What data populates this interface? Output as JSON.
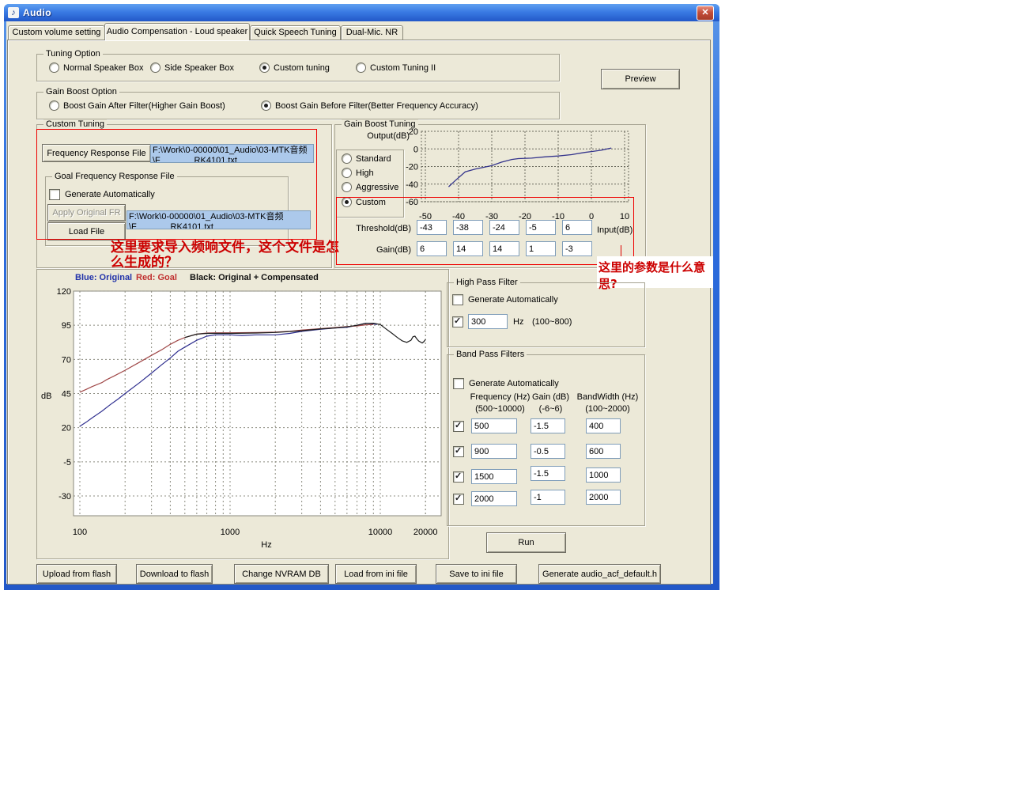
{
  "window": {
    "title": "Audio",
    "close_glyph": "✕",
    "app_icon_glyph": "♪"
  },
  "tabs": [
    {
      "label": "Custom volume setting",
      "active": false
    },
    {
      "label": "Audio Compensation - Loud speaker",
      "active": true
    },
    {
      "label": "Quick Speech Tuning",
      "active": false
    },
    {
      "label": "Dual-Mic. NR",
      "active": false
    }
  ],
  "tuning_option": {
    "title": "Tuning Option",
    "options": [
      {
        "label": "Normal Speaker Box",
        "selected": false
      },
      {
        "label": "Side Speaker Box",
        "selected": false
      },
      {
        "label": "Custom tuning",
        "selected": true
      },
      {
        "label": "Custom Tuning II",
        "selected": false
      }
    ]
  },
  "preview_button": "Preview",
  "gain_boost_option": {
    "title": "Gain Boost Option",
    "options": [
      {
        "label": "Boost Gain After Filter(Higher Gain Boost)",
        "selected": false
      },
      {
        "label": "Boost Gain Before Filter(Better Frequency Accuracy)",
        "selected": true
      }
    ]
  },
  "custom_tuning": {
    "title": "Custom Tuning",
    "frequency_response_button": "Frequency Response File",
    "fr_path_line1": "F:\\Work\\0-00000\\01_Audio\\03-MTK音频",
    "fr_path_line2": "\\F              RK4101.txt",
    "goal": {
      "title": "Goal Frequency Response File",
      "generate_automatically": {
        "label": "Generate Automatically",
        "checked": false
      },
      "apply_original_fr_button": "Apply Original FR",
      "load_file_button": "Load File",
      "path_line1": "F:\\Work\\0-00000\\01_Audio\\03-MTK音频",
      "path_line2": "\\F              RK4101.txt"
    }
  },
  "annotations": {
    "custom_tuning_note": "这里要求导入频响文件，这个文件是怎么生成的？",
    "params_note": "这里的参数是什么意思?"
  },
  "gain_boost_tuning": {
    "title": "Gain Boost Tuning",
    "output_label": "Output(dB)",
    "input_label": "Input(dB)",
    "modes": [
      {
        "label": "Standard",
        "selected": false
      },
      {
        "label": "High",
        "selected": false
      },
      {
        "label": "Aggressive",
        "selected": false
      },
      {
        "label": "Custom",
        "selected": true
      }
    ],
    "threshold_label": "Threshold(dB)",
    "thresholds": [
      "-43",
      "-38",
      "-24",
      "-5",
      "6"
    ],
    "gain_label": "Gain(dB)",
    "gains": [
      "6",
      "14",
      "14",
      "1",
      "-3"
    ]
  },
  "high_pass_filter": {
    "title": "High Pass Filter",
    "generate_automatically": {
      "label": "Generate Automatically",
      "checked": false
    },
    "row": {
      "checked": true,
      "frequency": "300",
      "unit": "Hz",
      "range": "(100~800)"
    }
  },
  "band_pass_filters": {
    "title": "Band Pass Filters",
    "generate_automatically": {
      "label": "Generate Automatically",
      "checked": false
    },
    "headers": {
      "frequency": "Frequency (Hz)",
      "frequency_range": "(500~10000)",
      "gain": "Gain (dB)",
      "gain_range": "(-6~6)",
      "bandwidth": "BandWidth (Hz)",
      "bandwidth_range": "(100~2000)"
    },
    "rows": [
      {
        "checked": true,
        "frequency": "500",
        "gain": "-1.5",
        "bandwidth": "400"
      },
      {
        "checked": true,
        "frequency": "900",
        "gain": "-0.5",
        "bandwidth": "600"
      },
      {
        "checked": true,
        "frequency": "1500",
        "gain": "-1.5",
        "bandwidth": "1000"
      },
      {
        "checked": true,
        "frequency": "2000",
        "gain": "-1",
        "bandwidth": "2000"
      }
    ]
  },
  "run_button": "Run",
  "bottom_buttons": [
    "Upload from flash",
    "Download to flash",
    "Change NVRAM DB",
    "Load from ini file",
    "Save to ini file",
    "Generate audio_acf_default.h"
  ],
  "chart_data": [
    {
      "name": "gain-boost-transfer",
      "type": "line",
      "xlabel": "Input(dB)",
      "ylabel": "Output(dB)",
      "xlim": [
        -50,
        10
      ],
      "ylim": [
        -60,
        20
      ],
      "xticks": [
        -50,
        -40,
        -30,
        -20,
        -10,
        0,
        10
      ],
      "yticks": [
        20,
        0,
        -20,
        -40,
        -60
      ],
      "grid": "dashed",
      "series": [
        {
          "name": "custom-gain-curve",
          "color": "#34348C",
          "points": [
            [
              -43,
              -43
            ],
            [
              -41,
              -36
            ],
            [
              -38,
              -26
            ],
            [
              -35,
              -23
            ],
            [
              -30,
              -19
            ],
            [
              -27,
              -15
            ],
            [
              -24,
              -12
            ],
            [
              -22,
              -11
            ],
            [
              -18,
              -10.5
            ],
            [
              -14,
              -9
            ],
            [
              -10,
              -8
            ],
            [
              -6,
              -6.5
            ],
            [
              -2,
              -4
            ],
            [
              0,
              -3
            ],
            [
              3,
              -1.5
            ],
            [
              6,
              1
            ]
          ]
        }
      ]
    },
    {
      "name": "frequency-response",
      "type": "line",
      "xscale": "log",
      "xlabel": "Hz",
      "ylabel": "dB",
      "xlim": [
        100,
        20000
      ],
      "ylim": [
        -45,
        120
      ],
      "xticks": [
        100,
        1000,
        10000,
        20000
      ],
      "yticks": [
        120,
        95,
        70,
        45,
        20,
        -5,
        -30
      ],
      "grid": "dashed",
      "legend": [
        {
          "label": "Blue: Original",
          "color": "#2233AA"
        },
        {
          "label": "Red: Goal",
          "color": "#C03030"
        },
        {
          "label": "Black: Original + Compensated",
          "color": "#111111"
        }
      ],
      "series": [
        {
          "name": "original",
          "color": "#2F2F8F",
          "points": [
            [
              100,
              21
            ],
            [
              110,
              24
            ],
            [
              120,
              27
            ],
            [
              140,
              32
            ],
            [
              160,
              37
            ],
            [
              180,
              41
            ],
            [
              200,
              45
            ],
            [
              250,
              53
            ],
            [
              300,
              60
            ],
            [
              350,
              66
            ],
            [
              400,
              71
            ],
            [
              450,
              76
            ],
            [
              500,
              79
            ],
            [
              600,
              84
            ],
            [
              700,
              87
            ],
            [
              800,
              88
            ],
            [
              1000,
              88
            ],
            [
              1200,
              87.5
            ],
            [
              1500,
              88
            ],
            [
              2000,
              88
            ],
            [
              2500,
              89
            ],
            [
              3000,
              90.5
            ],
            [
              4000,
              92
            ],
            [
              5000,
              93
            ],
            [
              6000,
              93.5
            ],
            [
              7000,
              95
            ],
            [
              8000,
              96.5
            ],
            [
              9000,
              96
            ],
            [
              9500,
              95.5
            ]
          ]
        },
        {
          "name": "goal",
          "color": "#A04848",
          "points": [
            [
              100,
              46
            ],
            [
              110,
              48
            ],
            [
              120,
              50
            ],
            [
              140,
              53
            ],
            [
              150,
              55
            ],
            [
              170,
              58
            ],
            [
              200,
              62
            ],
            [
              250,
              68
            ],
            [
              300,
              73
            ],
            [
              350,
              77
            ],
            [
              400,
              81
            ],
            [
              450,
              84
            ],
            [
              500,
              86
            ],
            [
              600,
              88.5
            ],
            [
              700,
              89.3
            ],
            [
              800,
              89.5
            ],
            [
              1000,
              89.5
            ],
            [
              1500,
              89.7
            ],
            [
              2000,
              90
            ],
            [
              2500,
              90.5
            ],
            [
              3000,
              91.5
            ],
            [
              4000,
              92.5
            ],
            [
              5000,
              93.3
            ],
            [
              6000,
              94
            ],
            [
              7000,
              94.5
            ],
            [
              8000,
              95.3
            ],
            [
              9000,
              95.5
            ]
          ]
        },
        {
          "name": "original-plus-compensated",
          "color": "#1C1C1C",
          "points": [
            [
              500,
              86
            ],
            [
              600,
              88.5
            ],
            [
              700,
              89
            ],
            [
              800,
              89
            ],
            [
              1000,
              89
            ],
            [
              1500,
              89.3
            ],
            [
              2000,
              89.7
            ],
            [
              3000,
              91
            ],
            [
              4000,
              92.3
            ],
            [
              5000,
              93
            ],
            [
              6000,
              93.8
            ],
            [
              7000,
              95
            ],
            [
              8000,
              96.3
            ],
            [
              9000,
              96.5
            ],
            [
              10000,
              95.5
            ],
            [
              11000,
              92
            ],
            [
              12000,
              89
            ],
            [
              13000,
              86
            ],
            [
              14000,
              83.5
            ],
            [
              15000,
              82.5
            ],
            [
              16000,
              84
            ],
            [
              16500,
              86.5
            ],
            [
              17000,
              87
            ],
            [
              17500,
              85
            ],
            [
              18000,
              83.5
            ],
            [
              19000,
              82
            ],
            [
              19500,
              83
            ],
            [
              20000,
              84.5
            ]
          ]
        }
      ]
    }
  ]
}
